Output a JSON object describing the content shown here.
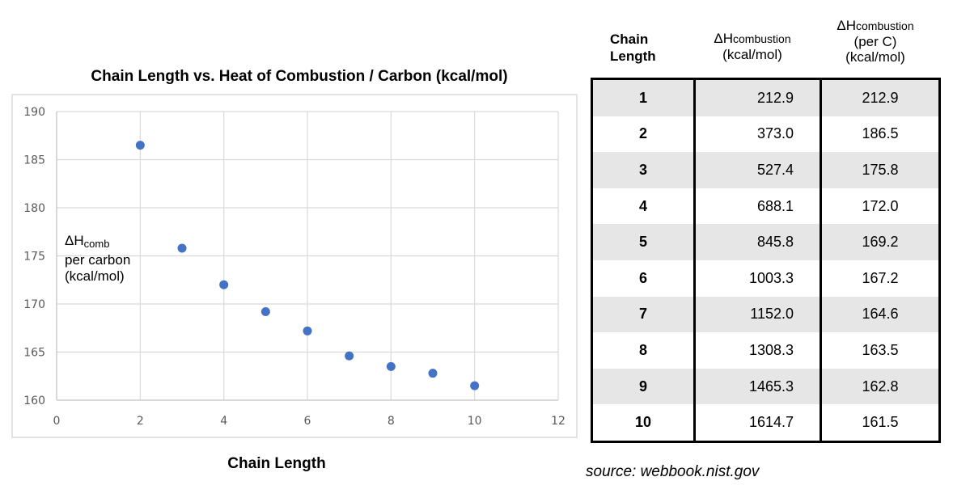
{
  "chart_data": {
    "type": "scatter",
    "title": "Chain Length vs. Heat of Combustion / Carbon (kcal/mol)",
    "xlabel": "Chain Length",
    "ylabel_lines": [
      "ΔH",
      "comb",
      "per carbon",
      "(kcal/mol)"
    ],
    "xlim": [
      0,
      12
    ],
    "ylim": [
      160,
      190
    ],
    "x_ticks": [
      0,
      2,
      4,
      6,
      8,
      10,
      12
    ],
    "y_ticks": [
      160,
      165,
      170,
      175,
      180,
      185,
      190
    ],
    "grid": true,
    "marker_color": "#4472C4",
    "x": [
      2,
      3,
      4,
      5,
      6,
      7,
      8,
      9,
      10
    ],
    "y": [
      186.5,
      175.8,
      172.0,
      169.2,
      167.2,
      164.6,
      163.5,
      162.8,
      161.5
    ]
  },
  "table": {
    "headers": {
      "chain_length": [
        "Chain",
        "Length"
      ],
      "dh_total": {
        "symbol": "ΔH",
        "sub": "combustion",
        "unit": "(kcal/mol)"
      },
      "dh_per_c": {
        "symbol": "ΔH",
        "sub": "combustion",
        "qualifier": "(per C)",
        "unit": "(kcal/mol)"
      }
    },
    "rows": [
      {
        "n": "1",
        "total": "212.9",
        "per_c": "212.9"
      },
      {
        "n": "2",
        "total": "373.0",
        "per_c": "186.5"
      },
      {
        "n": "3",
        "total": "527.4",
        "per_c": "175.8"
      },
      {
        "n": "4",
        "total": "688.1",
        "per_c": "172.0"
      },
      {
        "n": "5",
        "total": "845.8",
        "per_c": "169.2"
      },
      {
        "n": "6",
        "total": "1003.3",
        "per_c": "167.2"
      },
      {
        "n": "7",
        "total": "1152.0",
        "per_c": "164.6"
      },
      {
        "n": "8",
        "total": "1308.3",
        "per_c": "163.5"
      },
      {
        "n": "9",
        "total": "1465.3",
        "per_c": "162.8"
      },
      {
        "n": "10",
        "total": "1614.7",
        "per_c": "161.5"
      }
    ]
  },
  "source": "source: webbook.nist.gov"
}
